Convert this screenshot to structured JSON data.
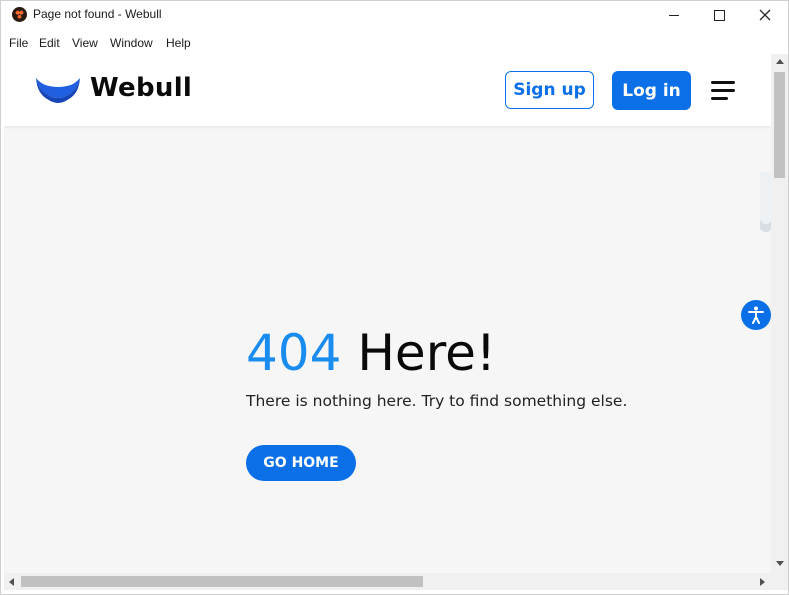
{
  "window": {
    "title": "Page not found - Webull",
    "controls": [
      "minimize",
      "maximize",
      "close"
    ]
  },
  "menubar": {
    "items": [
      "File",
      "Edit",
      "View",
      "Window",
      "Help"
    ]
  },
  "header": {
    "logo_text": "Webull",
    "signup_label": "Sign up",
    "login_label": "Log in",
    "menu_icon": "hamburger-menu-icon"
  },
  "error": {
    "code": "404",
    "title_rest": " Here!",
    "message": "There is nothing here. Try to find something else.",
    "home_button": "GO HOME"
  },
  "accessibility": {
    "icon": "accessibility-icon"
  },
  "colors": {
    "brand_blue": "#0b6fe8",
    "code_blue": "#1a8cf0",
    "page_bg": "#f6f6f6"
  }
}
